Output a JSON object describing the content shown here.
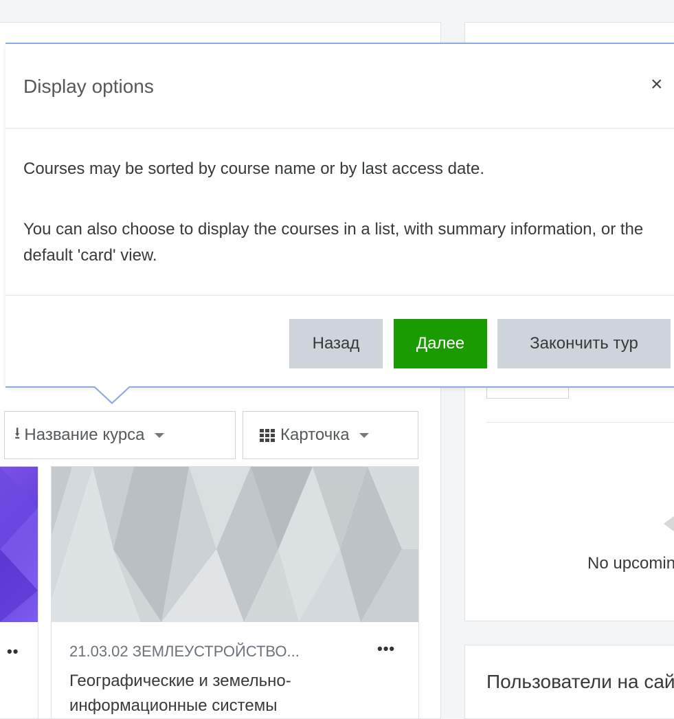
{
  "popover": {
    "title": "Display options",
    "close_symbol": "×",
    "paragraph_1": "Courses may be sorted by course name or by last access date.",
    "paragraph_2": "You can also choose to display the courses in a list, with summary information, or the default 'card' view.",
    "buttons": {
      "back": "Назад",
      "next": "Далее",
      "end_tour": "Закончить тур"
    }
  },
  "controls": {
    "sort_label": "Название курса",
    "view_label": "Карточка"
  },
  "course_card": {
    "category": "21.03.02 ЗЕМЛЕУСТРОЙСТВО...",
    "menu_symbol": "•••",
    "title": "Географические и земельно-информационные системы"
  },
  "left_card": {
    "menu_symbol": "••"
  },
  "right_panel": {
    "no_upcoming": "No upcoming activities due",
    "users_heading": "Пользователи на сайте"
  },
  "colors": {
    "accent_border": "#8fa8e6",
    "next_button": "#1a9c00",
    "secondary_button": "#ced4da"
  }
}
